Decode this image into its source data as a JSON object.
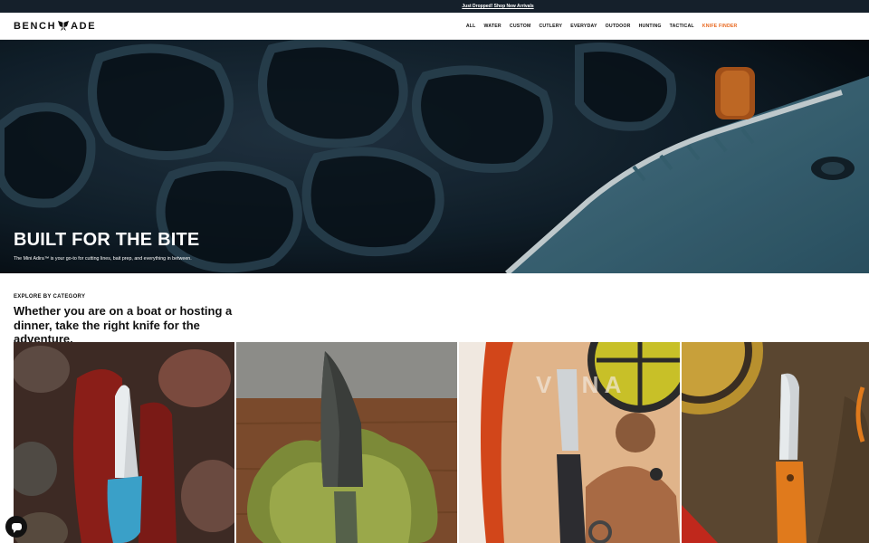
{
  "colors": {
    "accent": "#e8671e",
    "topbar": "#15202b"
  },
  "announcement": {
    "link_text": "Just Dropped! Shop New Arrivals"
  },
  "brand": {
    "left": "BENCH",
    "right": "ADE"
  },
  "nav": {
    "items": [
      {
        "label": "ALL"
      },
      {
        "label": "WATER"
      },
      {
        "label": "CUSTOM"
      },
      {
        "label": "CUTLERY"
      },
      {
        "label": "EVERYDAY"
      },
      {
        "label": "OUTDOOR"
      },
      {
        "label": "HUNTING"
      },
      {
        "label": "TACTICAL"
      },
      {
        "label": "KNIFE FINDER"
      }
    ]
  },
  "hero": {
    "title": "BUILT FOR THE BITE",
    "subtitle": "The Mini Adira™ is your go-to for cutting lines, bait prep, and everything in between."
  },
  "explore": {
    "label": "EXPLORE BY CATEGORY",
    "heading": "Whether you are on a boat or hosting a dinner, take the right knife for the adventure."
  },
  "tiles": [
    {
      "icon": "blue-fillet-knife-image"
    },
    {
      "icon": "fixed-blade-on-moss-image"
    },
    {
      "icon": "folding-knife-with-helmet-image"
    },
    {
      "icon": "orange-folding-knife-image"
    }
  ],
  "chat": {
    "icon": "chat-bubble-icon"
  }
}
